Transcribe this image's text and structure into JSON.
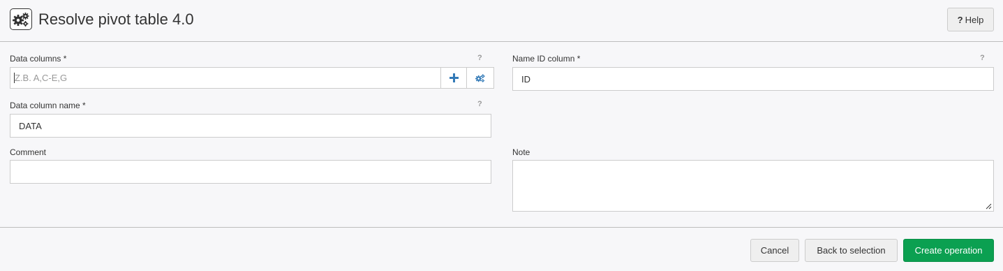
{
  "header": {
    "icon": "gears-icon",
    "title": "Resolve pivot table 4.0",
    "help_icon": "question-mark",
    "help_label": "Help"
  },
  "form": {
    "data_columns": {
      "label": "Data columns *",
      "help": "?",
      "placeholder": "Z.B. A,C-E,G",
      "add_icon": "plus-icon",
      "select_icon": "gears-icon"
    },
    "name_id_column": {
      "label": "Name ID column *",
      "help": "?",
      "value": "ID"
    },
    "data_column_name": {
      "label": "Data column name *",
      "help": "?",
      "value": "DATA"
    },
    "comment": {
      "label": "Comment",
      "value": ""
    },
    "note": {
      "label": "Note",
      "value": ""
    }
  },
  "footer": {
    "cancel_label": "Cancel",
    "back_label": "Back to selection",
    "create_label": "Create operation"
  },
  "colors": {
    "primary": "#0ba051",
    "accent_icon": "#337ab7"
  }
}
